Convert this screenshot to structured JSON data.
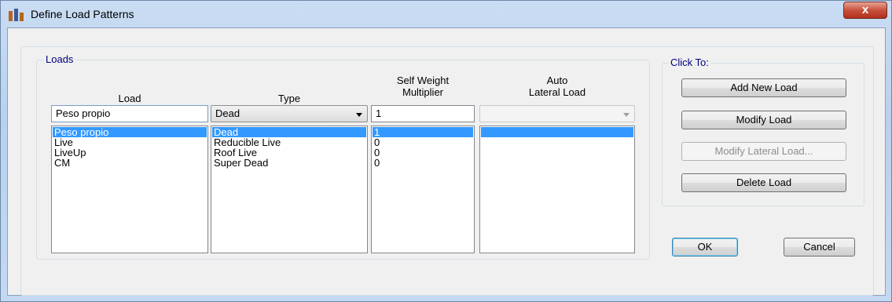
{
  "window": {
    "title": "Define Load Patterns",
    "close_label": "x"
  },
  "loads_group": {
    "legend": "Loads",
    "headers": {
      "load": "Load",
      "type": "Type",
      "self_weight_line1": "Self Weight",
      "self_weight_line2": "Multiplier",
      "auto_line1": "Auto",
      "auto_line2": "Lateral Load"
    },
    "load_input_value": "Peso propio",
    "type_combo_value": "Dead",
    "multiplier_input_value": "1",
    "auto_combo_value": "",
    "load_list": [
      "Peso propio",
      "Live",
      "LiveUp",
      "CM"
    ],
    "type_list": [
      "Dead",
      "Reducible Live",
      "Roof Live",
      "Super Dead"
    ],
    "multiplier_list": [
      "1",
      "0",
      "0",
      "0"
    ],
    "auto_list": [
      ""
    ],
    "selected_index": 0
  },
  "click_to": {
    "legend": "Click To:",
    "add_label": "Add New Load",
    "modify_label": "Modify Load",
    "modify_lateral_label": "Modify Lateral Load...",
    "delete_label": "Delete Load"
  },
  "buttons": {
    "ok": "OK",
    "cancel": "Cancel"
  },
  "colors": {
    "selection": "#3399ff",
    "legend_text": "#000080",
    "titlebar": "#c4d8f1",
    "close": "#c8513d"
  }
}
